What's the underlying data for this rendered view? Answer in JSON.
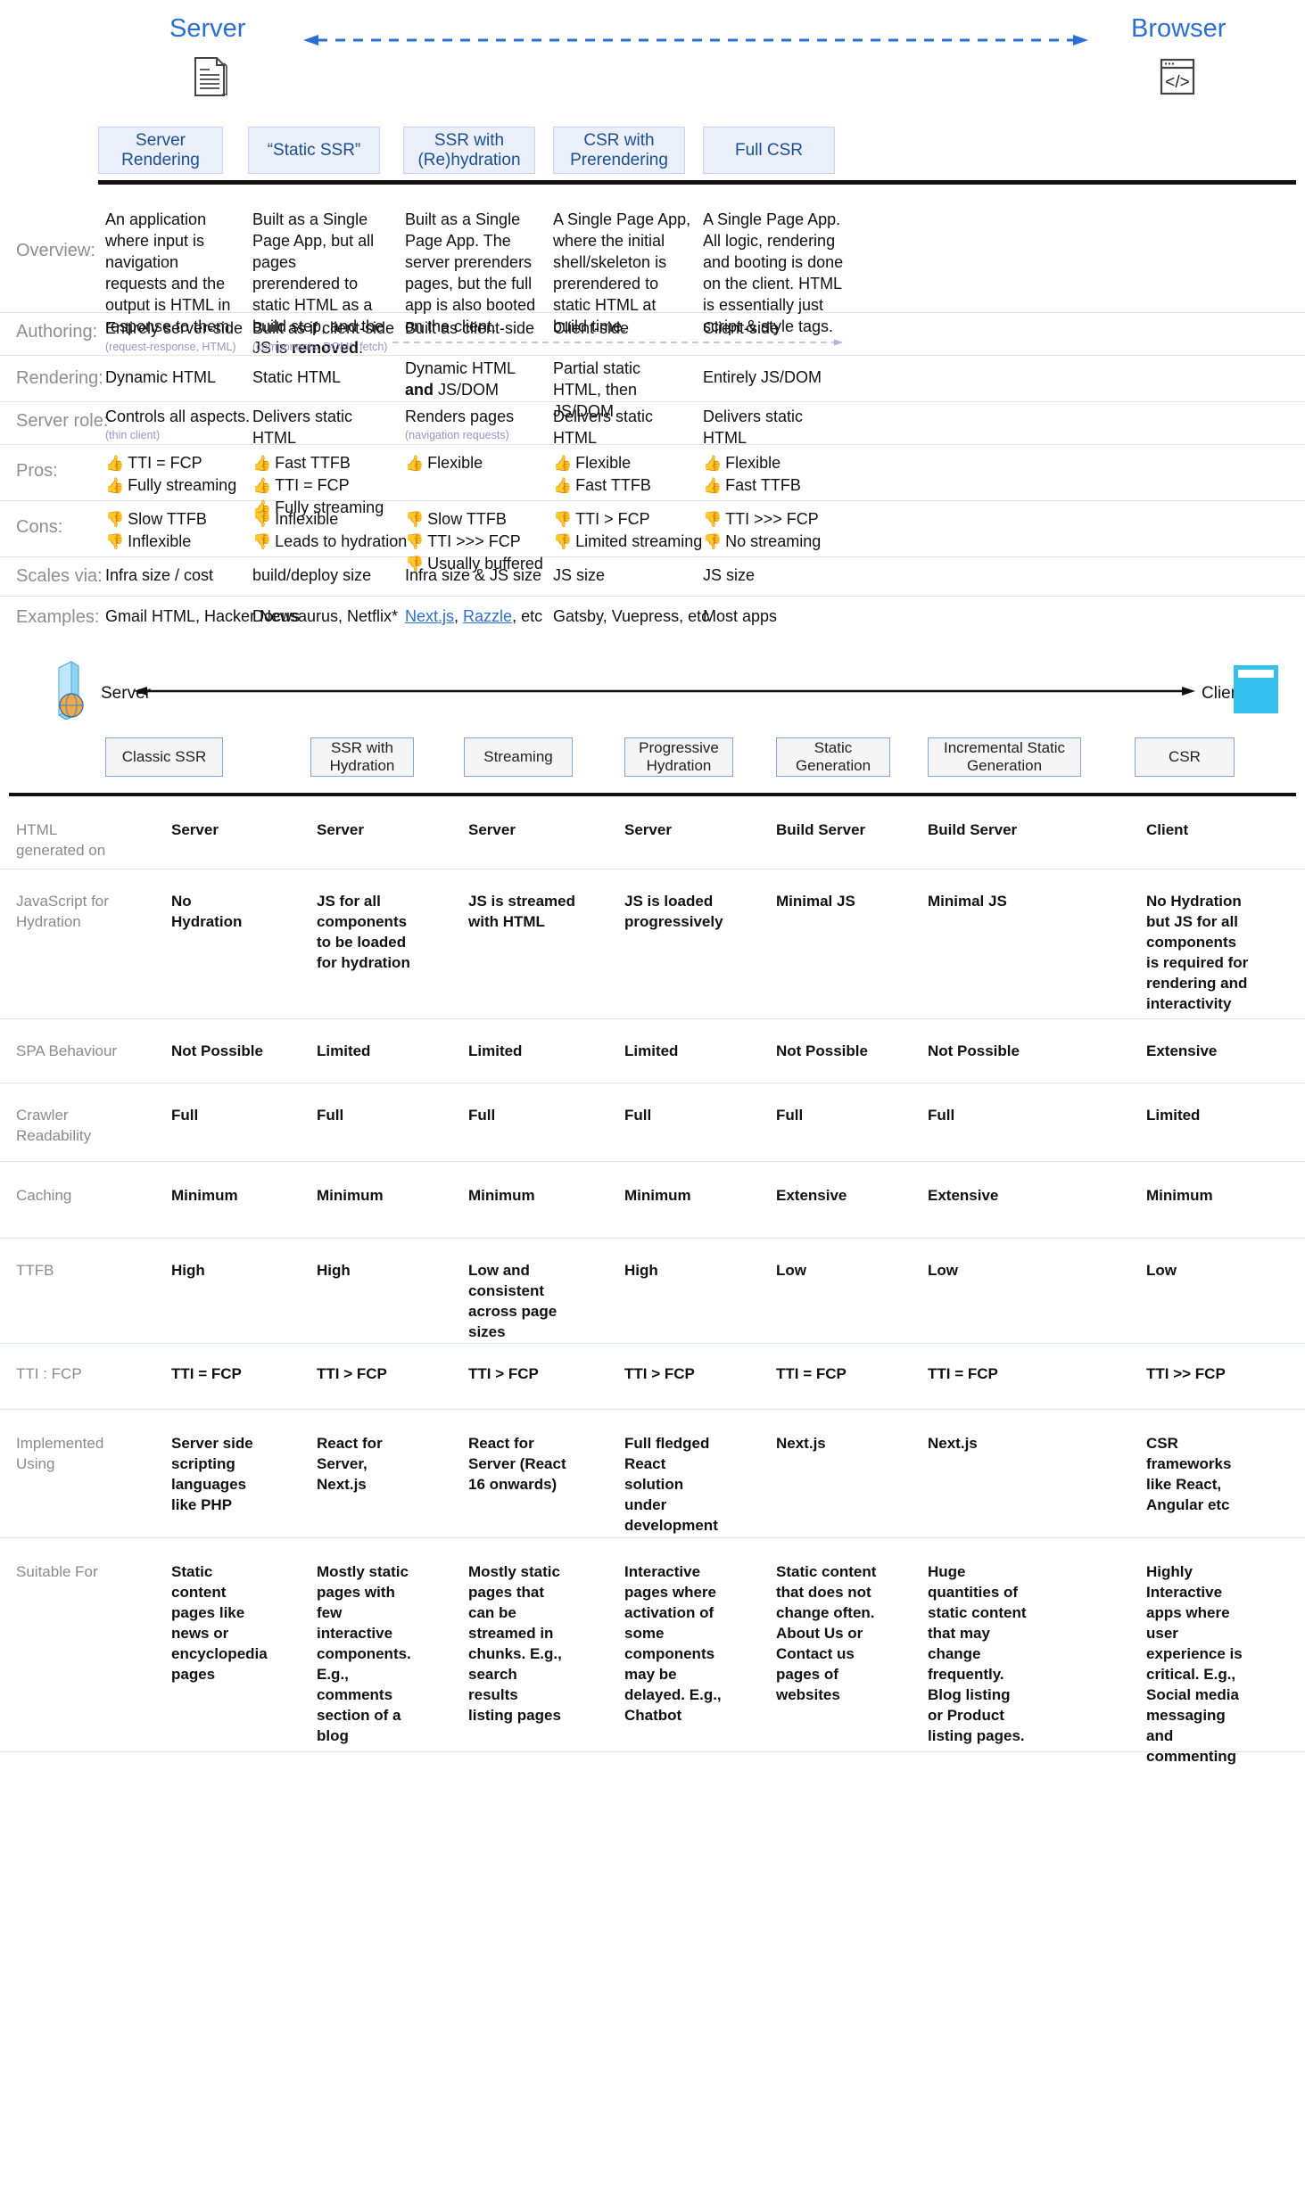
{
  "top_header": {
    "server_label": "Server",
    "browser_label": "Browser",
    "server_icon": "document-icon",
    "browser_icon": "browser-code-icon",
    "arrow_icon": "dashed-double-arrow-icon",
    "accent_blue": "#2a6fd6"
  },
  "top_table": {
    "columns": [
      "Server Rendering",
      "“Static SSR”",
      "SSR with (Re)hydration",
      "CSR with Prerendering",
      "Full CSR"
    ],
    "column_lines": [
      [
        "Server Rendering"
      ],
      [
        "“Static SSR”"
      ],
      [
        "SSR with",
        "(Re)hydration"
      ],
      [
        "CSR with",
        "Prerendering"
      ],
      [
        "Full CSR"
      ]
    ],
    "rows": [
      {
        "label": "Overview:",
        "cells": [
          "An application where input is navigation requests and the output is HTML in response to them.",
          "Built as a Single Page App, but all pages prerendered to static HTML as a build step, and the JS is removed.",
          "Built as a Single Page App. The server prerenders pages, but the full app is also booted on the client.",
          "A Single Page App, where the initial shell/skeleton is prerendered to static HTML at build time.",
          "A Single Page App. All logic, rendering and booting is done on the client. HTML is essentially just script & style tags."
        ]
      },
      {
        "label": "Authoring:",
        "cells": [
          "Entirely server-side",
          "Built as if client-side",
          "Built as client-side",
          "Client-side",
          "Client-side"
        ],
        "subs": [
          "(request-response, HTML)",
          "(components, DOM*, fetch)",
          "",
          "",
          ""
        ]
      },
      {
        "label": "Rendering:",
        "cells": [
          "Dynamic HTML",
          "Static HTML",
          "Dynamic HTML and JS/DOM",
          "Partial static HTML, then JS/DOM",
          "Entirely JS/DOM"
        ]
      },
      {
        "label": "Server role:",
        "cells": [
          "Controls all aspects.",
          "Delivers static HTML",
          "Renders pages",
          "Delivers static HTML",
          "Delivers static HTML"
        ],
        "subs": [
          "(thin client)",
          "",
          "(navigation requests)",
          "",
          ""
        ]
      },
      {
        "label": "Pros:",
        "icon": "thumbs-up-icon",
        "bullets": [
          [
            "TTI = FCP",
            "Fully streaming"
          ],
          [
            "Fast TTFB",
            "TTI = FCP",
            "Fully streaming"
          ],
          [
            "Flexible"
          ],
          [
            "Flexible",
            "Fast TTFB"
          ],
          [
            "Flexible",
            "Fast TTFB"
          ]
        ]
      },
      {
        "label": "Cons:",
        "icon": "thumbs-down-icon",
        "bullets": [
          [
            "Slow TTFB",
            "Inflexible"
          ],
          [
            "Inflexible",
            "Leads to hydration"
          ],
          [
            "Slow TTFB",
            "TTI >>> FCP",
            "Usually buffered"
          ],
          [
            "TTI > FCP",
            "Limited streaming"
          ],
          [
            "TTI >>> FCP",
            "No streaming"
          ]
        ]
      },
      {
        "label": "Scales via:",
        "cells": [
          "Infra size / cost",
          "build/deploy size",
          "Infra size & JS size",
          "JS size",
          "JS size"
        ]
      },
      {
        "label": "Examples:",
        "cells": [
          "Gmail HTML, Hacker News",
          "Docusaurus, Netflix*",
          "",
          "Gatsby, Vuepress, etc",
          "Most apps"
        ],
        "links_cell_index": 2,
        "links": [
          {
            "text": "Next.js",
            "link": true
          },
          {
            "text": ", ",
            "link": false
          },
          {
            "text": "Razzle",
            "link": true
          },
          {
            "text": ", etc",
            "link": false
          }
        ]
      }
    ]
  },
  "mid_band": {
    "server_label": "Server",
    "client_label": "Client",
    "server_icon": "server-stack-icon",
    "client_icon": "client-window-icon",
    "arrow_icon": "double-headed-arrow-icon"
  },
  "bottom_table": {
    "columns": [
      "Classic SSR",
      "SSR with Hydration",
      "Streaming",
      "Progressive Hydration",
      "Static Generation",
      "Incremental Static Generation",
      "CSR"
    ],
    "column_lines": [
      [
        "Classic SSR"
      ],
      [
        "SSR with",
        "Hydration"
      ],
      [
        "Streaming"
      ],
      [
        "Progressive",
        "Hydration"
      ],
      [
        "Static",
        "Generation"
      ],
      [
        "Incremental Static",
        "Generation"
      ],
      [
        "CSR"
      ]
    ],
    "rows": [
      {
        "label": "HTML generated on",
        "cells": [
          "Server",
          "Server",
          "Server",
          "Server",
          "Build Server",
          "Build Server",
          "Client"
        ]
      },
      {
        "label": "JavaScript for Hydration",
        "cells": [
          "No Hydration",
          "JS for all components to be loaded for hydration",
          "JS is streamed with HTML",
          "JS is loaded progressively",
          "Minimal JS",
          "Minimal JS",
          "No Hydration but JS for all components is required for rendering and interactivity"
        ]
      },
      {
        "label": "SPA Behaviour",
        "cells": [
          "Not Possible",
          "Limited",
          "Limited",
          "Limited",
          "Not Possible",
          "Not Possible",
          "Extensive"
        ]
      },
      {
        "label": "Crawler Readability",
        "cells": [
          "Full",
          "Full",
          "Full",
          "Full",
          "Full",
          "Full",
          "Limited"
        ]
      },
      {
        "label": "Caching",
        "cells": [
          "Minimum",
          "Minimum",
          "Minimum",
          "Minimum",
          "Extensive",
          "Extensive",
          "Minimum"
        ]
      },
      {
        "label": "TTFB",
        "cells": [
          "High",
          "High",
          "Low and consistent across page sizes",
          "High",
          "Low",
          "Low",
          "Low"
        ]
      },
      {
        "label": "TTI : FCP",
        "cells": [
          "TTI = FCP",
          "TTI > FCP",
          "TTI > FCP",
          "TTI > FCP",
          "TTI = FCP",
          "TTI = FCP",
          "TTI >> FCP"
        ]
      },
      {
        "label": "Implemented Using",
        "cells": [
          "Server side scripting languages like PHP",
          "React for Server, Next.js",
          "React for Server (React 16 onwards)",
          "Full fledged React solution under development",
          "Next.js",
          "Next.js",
          "CSR frameworks like React, Angular etc"
        ]
      },
      {
        "label": "Suitable For",
        "cells": [
          "Static content pages like news or encyclopedia pages",
          "Mostly static pages with few interactive components. E.g., comments section of a blog",
          "Mostly static pages that can be streamed in chunks. E.g., search results listing pages",
          "Interactive pages where activation of some components may be delayed. E.g., Chatbot",
          "Static content that does not change often. About Us or Contact us pages of websites",
          "Huge quantities of static content that may change frequently. Blog listing or Product listing pages.",
          "Highly Interactive apps where user experience is critical. E.g., Social media messaging and commenting"
        ]
      }
    ]
  }
}
